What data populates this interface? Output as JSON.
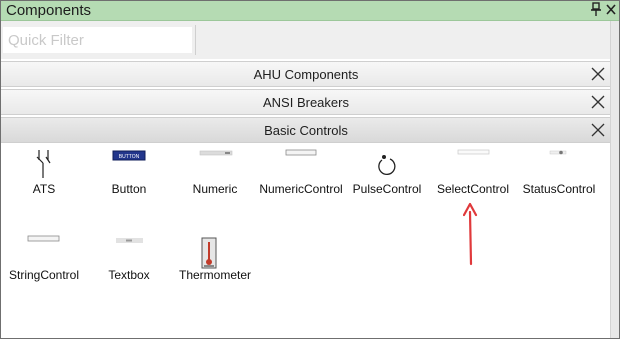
{
  "panel": {
    "title": "Components"
  },
  "filter": {
    "placeholder": "Quick Filter",
    "value": ""
  },
  "groups": [
    {
      "label": "AHU Components"
    },
    {
      "label": "ANSI Breakers"
    },
    {
      "label": "Basic Controls"
    }
  ],
  "controls": [
    {
      "label": "ATS",
      "icon": "ats-icon"
    },
    {
      "label": "Button",
      "icon": "button-preview-icon",
      "preview_text": "BUTTON"
    },
    {
      "label": "Numeric",
      "icon": "numeric-preview-icon"
    },
    {
      "label": "NumericControl",
      "icon": "numeric-control-preview-icon"
    },
    {
      "label": "PulseControl",
      "icon": "pulse-refresh-icon"
    },
    {
      "label": "SelectControl",
      "icon": "select-control-preview-icon"
    },
    {
      "label": "StatusControl",
      "icon": "status-control-preview-icon"
    },
    {
      "label": "StringControl",
      "icon": "string-control-preview-icon"
    },
    {
      "label": "Textbox",
      "icon": "textbox-preview-icon"
    },
    {
      "label": "Thermometer",
      "icon": "thermometer-icon"
    }
  ],
  "annotation": {
    "type": "arrow",
    "color": "#e0393b",
    "points_to": "SelectControl"
  }
}
